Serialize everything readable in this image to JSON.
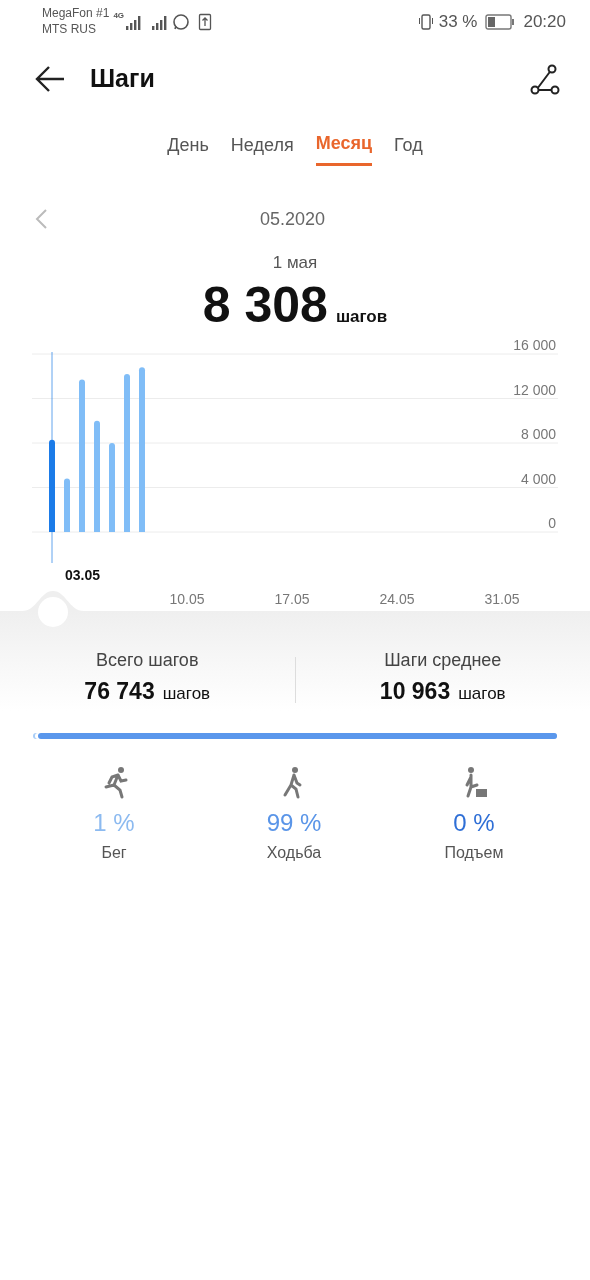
{
  "status_bar": {
    "carriers": [
      "MegaFon #1",
      "MTS RUS"
    ],
    "network": "4G",
    "battery_percent": "33 %",
    "time": "20:20"
  },
  "header": {
    "title": "Шаги"
  },
  "tabs": [
    {
      "label": "День",
      "selected": false
    },
    {
      "label": "Неделя",
      "selected": false
    },
    {
      "label": "Месяц",
      "selected": true
    },
    {
      "label": "Год",
      "selected": false
    }
  ],
  "period": {
    "label": "05.2020"
  },
  "selection": {
    "date": "1 мая",
    "value": "8 308",
    "unit": "шагов"
  },
  "chart": {
    "cursor_label": "03.05",
    "bars": [
      {
        "selected": true
      },
      {
        "selected": false
      },
      {
        "selected": false
      },
      {
        "selected": false
      },
      {
        "selected": false
      },
      {
        "selected": false
      },
      {
        "selected": false
      }
    ],
    "chart_data": {
      "type": "bar",
      "grid": true,
      "ylim": [
        0,
        16000
      ],
      "categories": [
        null,
        null,
        null,
        null,
        null,
        null,
        null,
        null,
        null,
        "10.05",
        null,
        null,
        null,
        null,
        null,
        null,
        "17.05",
        null,
        null,
        null,
        null,
        null,
        null,
        "24.05",
        null,
        null,
        null,
        null,
        null,
        null,
        "31.05"
      ],
      "yticks": [
        {
          "value": 0,
          "label": "0"
        },
        {
          "value": 4000,
          "label": "4 000"
        },
        {
          "value": 8000,
          "label": "8 000"
        },
        {
          "value": 12000,
          "label": "12 000"
        },
        {
          "value": 16000,
          "label": "16 000"
        }
      ],
      "values": [
        8300,
        4800,
        13700,
        10000,
        8000,
        14200,
        14800,
        null,
        null,
        null,
        null,
        null,
        null,
        null,
        null,
        null,
        null,
        null,
        null,
        null,
        null,
        null,
        null,
        null,
        null,
        null,
        null,
        null,
        null,
        null,
        null
      ]
    }
  },
  "summary": [
    {
      "label": "Всего шагов",
      "value": "76 743",
      "unit": "шагов"
    },
    {
      "label": "Шаги среднее",
      "value": "10 963",
      "unit": "шагов"
    }
  ],
  "breakdown": {
    "level": 0.99
  },
  "activities": [
    {
      "kind": "run",
      "percent": "1 %",
      "label": "Бег",
      "color": "#8cbaf0"
    },
    {
      "kind": "walk",
      "percent": "99 %",
      "label": "Ходьба",
      "color": "#5a95e8"
    },
    {
      "kind": "climb",
      "percent": "0 %",
      "label": "Подъем",
      "color": "#2f6fd6"
    }
  ]
}
